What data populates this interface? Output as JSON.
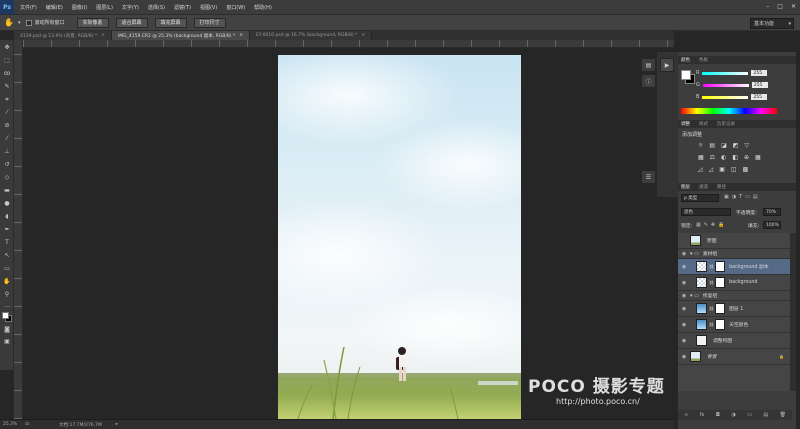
{
  "app": {
    "logo": "Ps"
  },
  "menu": [
    "文件(F)",
    "编辑(E)",
    "图像(I)",
    "图层(L)",
    "文字(Y)",
    "选择(S)",
    "滤镜(T)",
    "视图(V)",
    "窗口(W)",
    "帮助(H)"
  ],
  "window_controls": [
    "–",
    "□",
    "✕"
  ],
  "options": {
    "scroll_all_label": "滚动所有窗口",
    "buttons": [
      "实际像素",
      "适合屏幕",
      "填充屏幕",
      "打印尺寸"
    ],
    "workspace": "基本功能"
  },
  "tabs": [
    {
      "label": "4159.psd @ 13.9% (背景, RGB/8) *",
      "active": false
    },
    {
      "label": "IMG_4159.CR2 @ 25.3% (background 副本, RGB/8) *",
      "active": true
    },
    {
      "label": "EY-0010.psd @ 16.7% (background, RGB/8) *",
      "active": false
    }
  ],
  "status": {
    "zoom": "25.3%",
    "doc": "文档:17.7M/276.7M"
  },
  "color_panel": {
    "tabs": [
      "颜色",
      "色板"
    ],
    "channels": [
      {
        "label": "R",
        "value": "255"
      },
      {
        "label": "G",
        "value": "255"
      },
      {
        "label": "B",
        "value": "255"
      }
    ],
    "colors": {
      "foreground": "#ffffff",
      "background": "#000000"
    }
  },
  "adjust_panel": {
    "tabs": [
      "调整",
      "样式",
      "历史记录"
    ],
    "title": "添加调整",
    "rows": [
      [
        "☼",
        "▤",
        "◪",
        "◩",
        "▽"
      ],
      [
        "▦",
        "⚖",
        "◐",
        "◧",
        "⊕",
        "▦"
      ],
      [
        "◿",
        "◿",
        "▣",
        "◫",
        "▩"
      ]
    ]
  },
  "layers_panel": {
    "tabs": [
      "图层",
      "通道",
      "路径"
    ],
    "kind": "ρ 类型",
    "blend_mode": "滤色",
    "opacity_label": "不透明度:",
    "opacity": "70%",
    "lock_label": "锁定:",
    "fill_label": "填充:",
    "fill": "100%",
    "layers": [
      {
        "name": "原图",
        "visible": false,
        "type": "layer",
        "thumb": "photo",
        "mask": false,
        "selected": false,
        "indent": 0
      },
      {
        "name": "素材组",
        "visible": true,
        "type": "group",
        "indent": 0
      },
      {
        "name": "background 副本",
        "visible": true,
        "type": "layer",
        "thumb": "check",
        "mask": true,
        "selected": true,
        "indent": 1
      },
      {
        "name": "background",
        "visible": true,
        "type": "layer",
        "thumb": "check",
        "mask": true,
        "selected": false,
        "indent": 1
      },
      {
        "name": "修复组",
        "visible": true,
        "type": "group",
        "indent": 0
      },
      {
        "name": "图层 1",
        "visible": true,
        "type": "layer",
        "thumb": "blue",
        "mask": true,
        "selected": false,
        "indent": 1
      },
      {
        "name": "天空颜色",
        "visible": true,
        "type": "layer",
        "thumb": "blue",
        "mask": true,
        "selected": false,
        "indent": 1
      },
      {
        "name": "调整构图",
        "visible": true,
        "type": "layer",
        "thumb": "white",
        "mask": false,
        "selected": false,
        "indent": 1
      },
      {
        "name": "背景",
        "visible": true,
        "type": "layer",
        "thumb": "photo",
        "mask": false,
        "selected": false,
        "indent": 0,
        "italic": true,
        "locked": true
      }
    ],
    "footer_icons": [
      "∞",
      "fx",
      "◘",
      "◑",
      "▭",
      "▤",
      "🗑"
    ]
  },
  "watermark": {
    "brand": "POCO 摄影专题",
    "url": "http://photo.poco.cn/"
  }
}
